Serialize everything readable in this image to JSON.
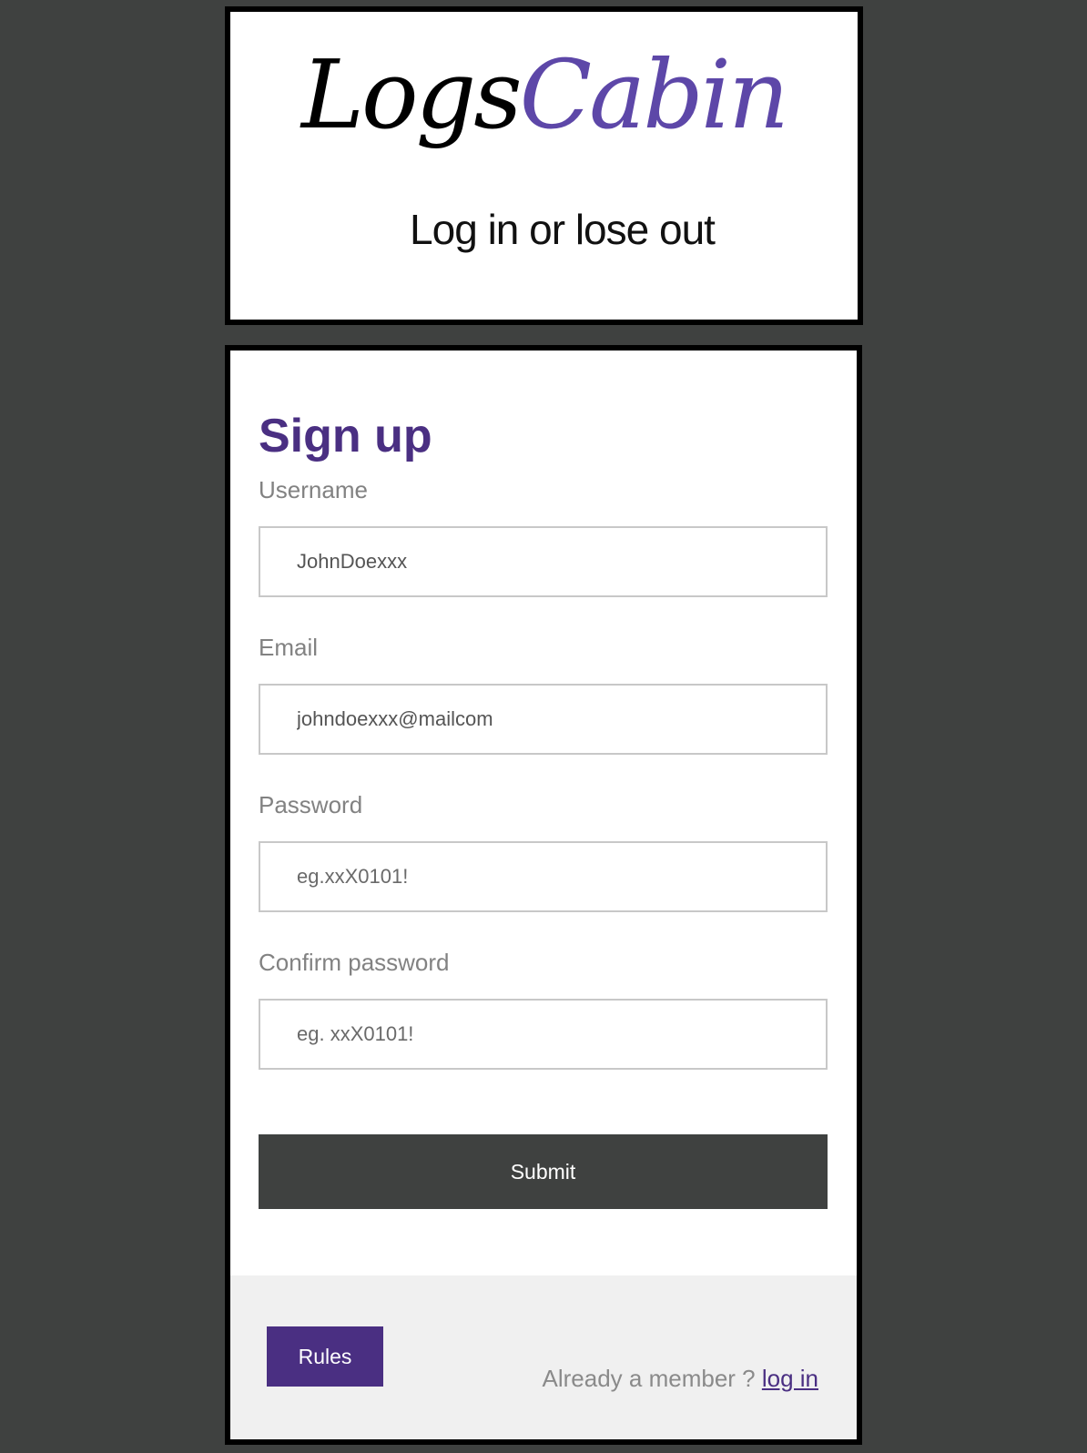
{
  "logo": {
    "part_logs": "Logs",
    "part_cabin": "Cabin",
    "tagline": "Log in or lose out",
    "colors": {
      "logs": "#000000",
      "cabin": "#5d47a8"
    }
  },
  "form": {
    "title": "Sign up",
    "username": {
      "label": "Username",
      "value": "JohnDoexxx",
      "placeholder": ""
    },
    "email": {
      "label": "Email",
      "value": "johndoexxx@mailcom",
      "placeholder": ""
    },
    "password": {
      "label": "Password",
      "value": "",
      "placeholder": "eg.xxX0101!"
    },
    "confirm_password": {
      "label": "Confirm password",
      "value": "",
      "placeholder": "eg. xxX0101!"
    },
    "submit_label": "Submit"
  },
  "footer": {
    "rules_label": "Rules",
    "member_text": "Already a member ? ",
    "login_link": "log in"
  },
  "colors": {
    "page_background": "#3f4140",
    "accent": "#4a2f82",
    "button_dark": "#3f4140",
    "footer_background": "#f0f0f0"
  }
}
